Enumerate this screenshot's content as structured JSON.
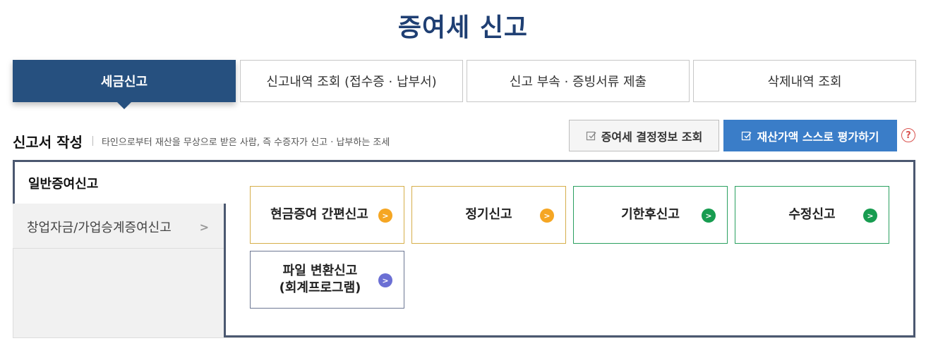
{
  "page": {
    "title": "증여세 신고"
  },
  "tabs": [
    {
      "label": "세금신고",
      "active": true
    },
    {
      "label": "신고내역 조회 (접수증 · 납부서)",
      "active": false
    },
    {
      "label": "신고 부속 · 증빙서류 제출",
      "active": false
    },
    {
      "label": "삭제내역 조회",
      "active": false
    }
  ],
  "section": {
    "title": "신고서 작성",
    "description": "타인으로부터 재산을 무상으로 받은 사람, 즉 수증자가 신고 · 납부하는 조세"
  },
  "actions": {
    "gift_info_label": "증여세 결정정보 조회",
    "self_eval_label": "재산가액 스스로 평가하기",
    "help_symbol": "?"
  },
  "sidebar": {
    "items": [
      {
        "label": "일반증여신고",
        "active": true
      },
      {
        "label": "창업자금/가업승계증여신고",
        "active": false,
        "chevron": ">"
      }
    ]
  },
  "cards": [
    {
      "label": "현금증여 간편신고",
      "color": "#f5a623",
      "arrow": ">"
    },
    {
      "label": "정기신고",
      "color": "#f5a623",
      "arrow": ">"
    },
    {
      "label": "기한후신고",
      "color": "#179c50",
      "arrow": ">"
    },
    {
      "label": "수정신고",
      "color": "#179c50",
      "arrow": ">"
    },
    {
      "label": "파일 변환신고\n(회계프로그램)",
      "color": "#6b6fd4",
      "arrow": ">"
    }
  ],
  "icons": {
    "check": "checkbox-edit-icon",
    "help": "question-circle-icon",
    "chevron": "chevron-right-icon",
    "arrow": "arrow-circle-right-icon"
  }
}
